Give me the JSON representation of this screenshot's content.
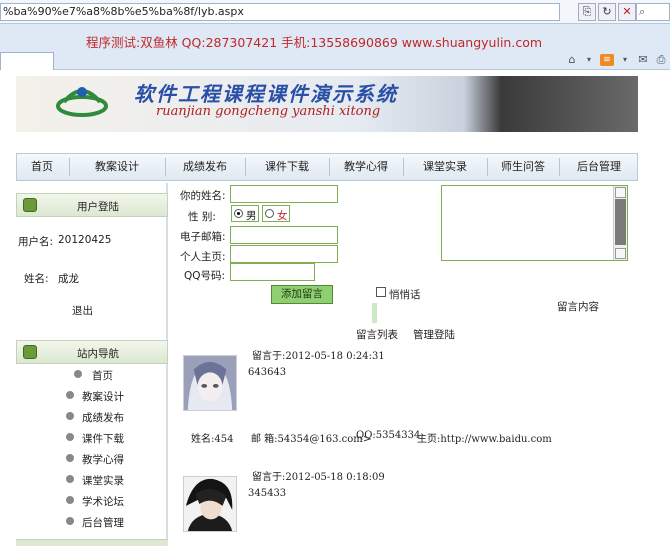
{
  "browser": {
    "url": "%ba%90%e7%a8%8b%e5%ba%8f/lyb.aspx",
    "promo": "程序测试:双鱼林 QQ:287307421 手机:13558690869 www.shuangyulin.com"
  },
  "banner": {
    "title": "软件工程课程课件演示系统",
    "subtitle": "ruanjian gongcheng yanshi xitong"
  },
  "nav": {
    "items": [
      "首页",
      "教案设计",
      "成绩发布",
      "课件下载",
      "教学心得",
      "课堂实录",
      "师生问答",
      "后台管理"
    ]
  },
  "sidebar": {
    "login_title": "用户登陆",
    "username_label": "用户名:",
    "username_value": "20120425",
    "name_label": "姓名:",
    "name_value": "成龙",
    "logout": "退出",
    "site_nav_title": "站内导航",
    "links": [
      "首页",
      "教案设计",
      "成绩发布",
      "课件下载",
      "教学心得",
      "课堂实录",
      "学术论坛",
      "后台管理"
    ]
  },
  "form": {
    "name_label": "你的姓名:",
    "gender_label": "性 别:",
    "male": "男",
    "female": "女",
    "email_label": "电子邮箱:",
    "homepage_label": "个人主页:",
    "qq_label": "QQ号码:",
    "submit": "添加留言",
    "private_label": "悄悄话",
    "content_label": "留言内容",
    "message_list_link": "留言列表",
    "admin_link": "管理登陆"
  },
  "messages": [
    {
      "time": "留言于:2012-05-18 0:24:31",
      "text": "643643",
      "name": "姓名:454",
      "email": "邮 箱:54354@163.com>",
      "qq": "QQ:5354334",
      "homepage": "主页:http://www.baidu.com"
    },
    {
      "time": "留言于:2012-05-18 0:18:09",
      "text": "345433"
    }
  ]
}
